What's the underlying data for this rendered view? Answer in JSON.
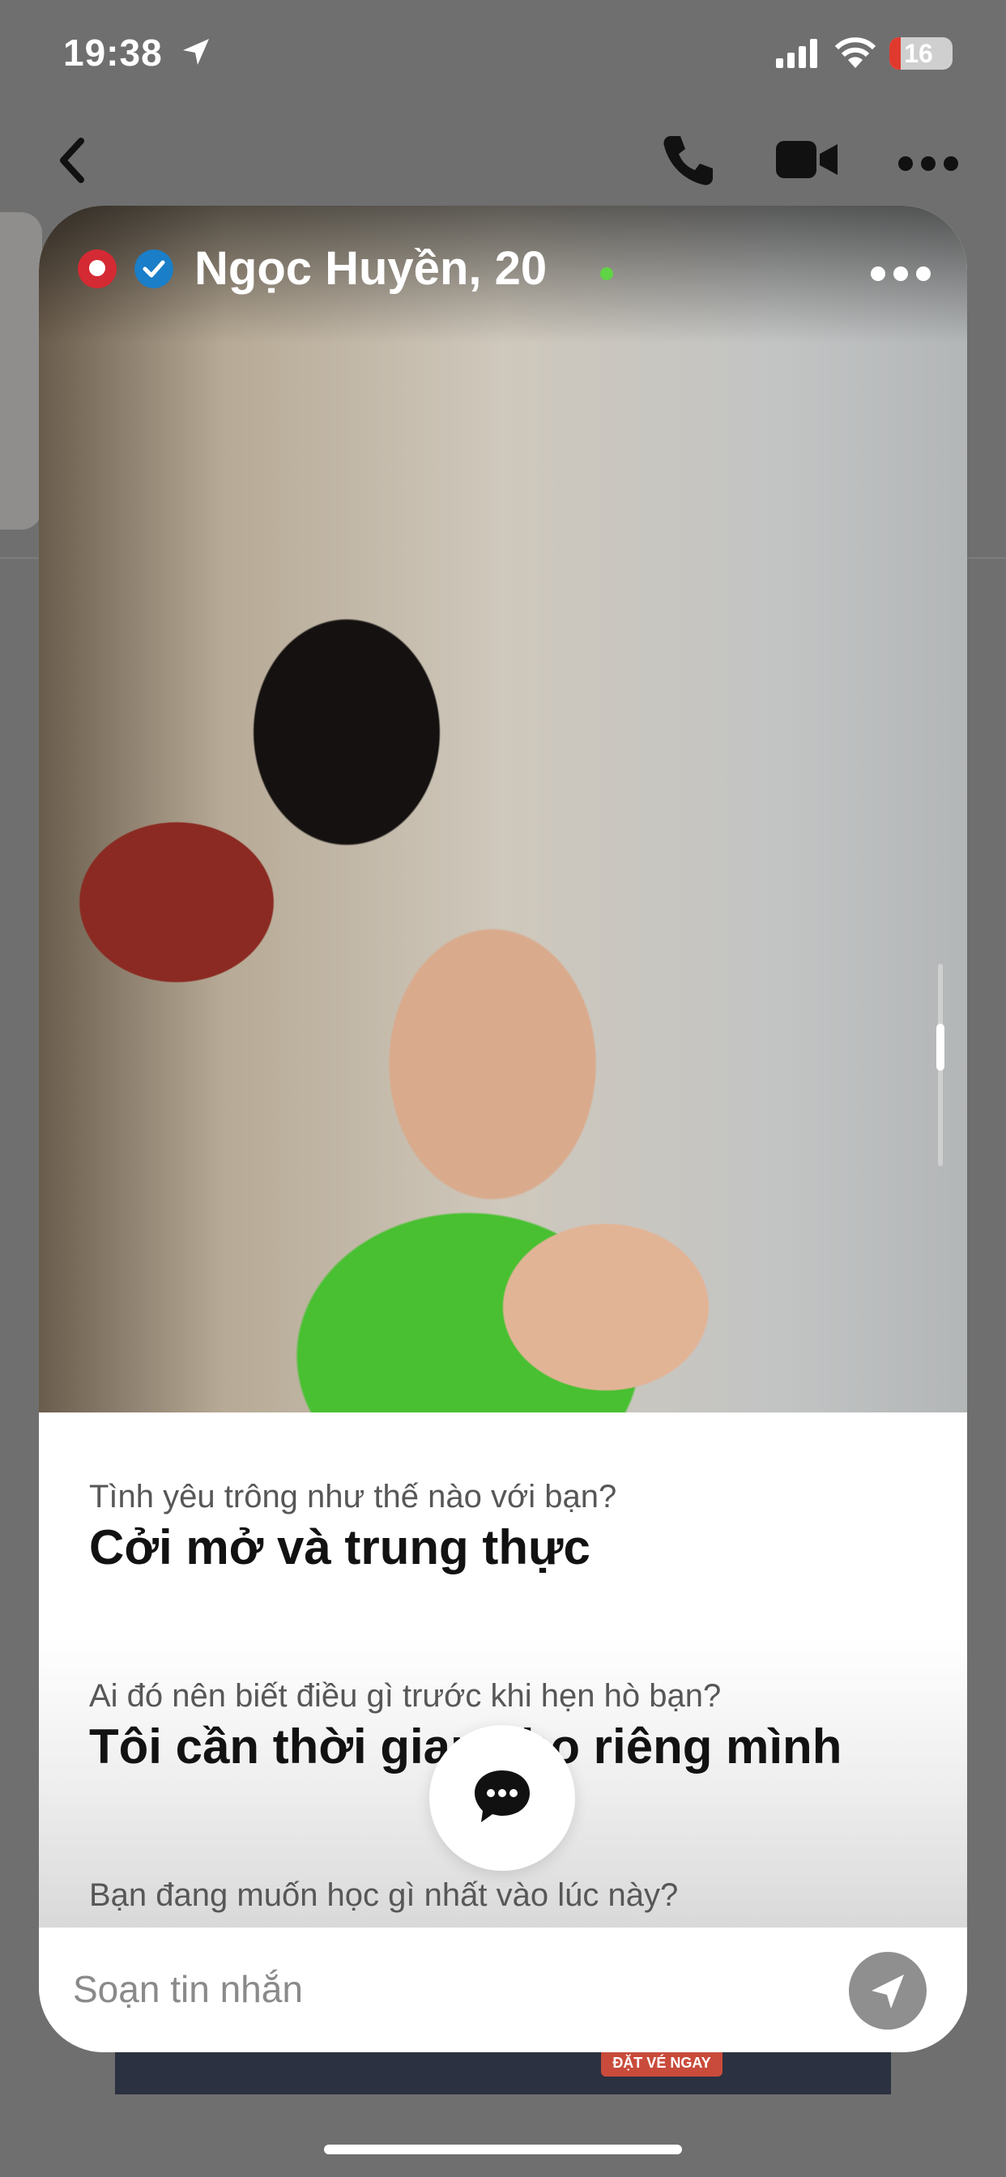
{
  "status_bar": {
    "time": "19:38",
    "battery": "16"
  },
  "profile": {
    "name": "Ngọc Huyền, 20",
    "photo_alt": "Profile photo"
  },
  "prompts": [
    {
      "question": "Tình yêu trông như thế nào với bạn?",
      "answer": "Cởi mở và trung thực"
    },
    {
      "question": "Ai đó nên biết điều gì trước khi hẹn hò bạn?",
      "answer": "Tôi cần thời gian cho riêng mình"
    },
    {
      "question": "Bạn đang muốn học gì nhất vào lúc này?",
      "answer": ""
    }
  ],
  "composer": {
    "placeholder": "Soạn tin nhắn"
  },
  "banner": {
    "cta": "ĐẶT VÉ NGAY"
  },
  "colors": {
    "verified_blue": "#1a7ec8",
    "brand_red": "#d42a33",
    "online_green": "#5fd444",
    "send_button": "#8f8f8f"
  },
  "icons": [
    "location-arrow-icon",
    "signal-icon",
    "wifi-icon",
    "battery-icon",
    "back-chevron-icon",
    "phone-icon",
    "video-icon",
    "more-icon",
    "brand-logo-icon",
    "verified-icon",
    "online-dot-icon",
    "menu-dots-icon",
    "chat-bubble-icon",
    "send-icon"
  ]
}
